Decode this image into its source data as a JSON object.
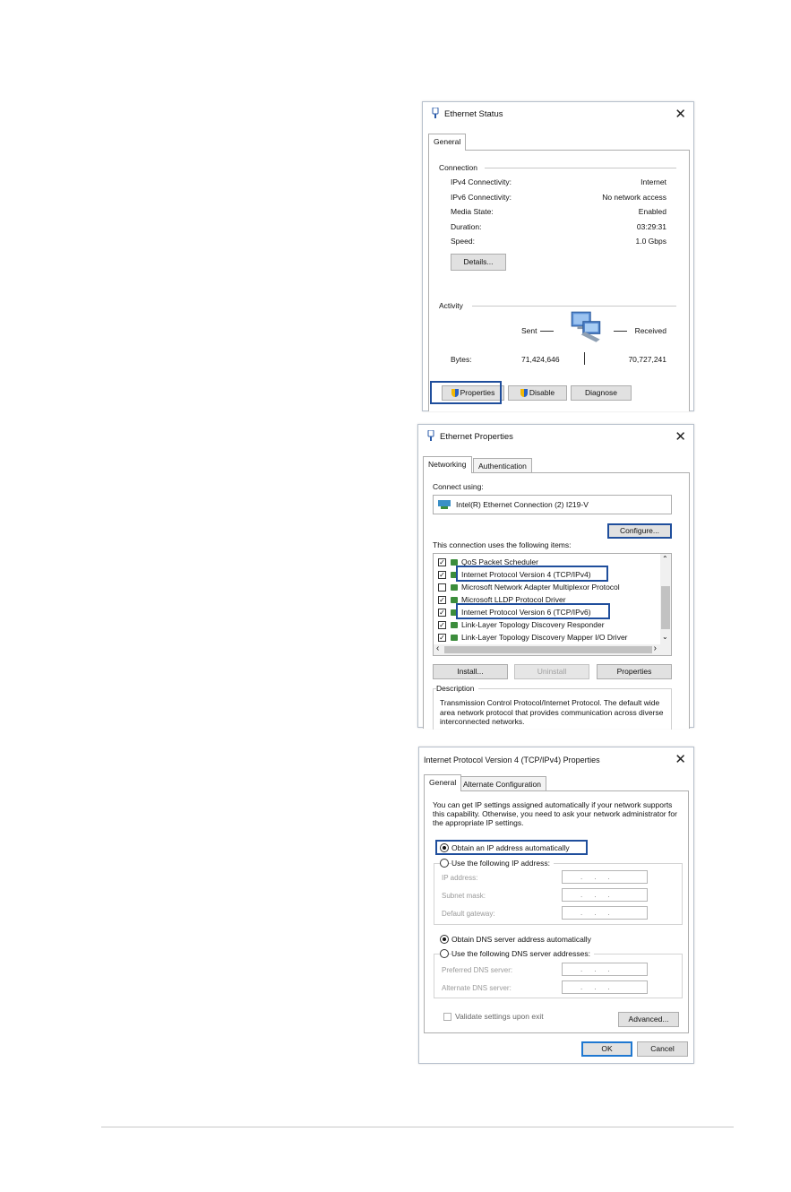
{
  "status_dialog": {
    "title": "Ethernet Status",
    "tab": "General",
    "connection_label": "Connection",
    "rows": [
      {
        "label": "IPv4 Connectivity:",
        "value": "Internet"
      },
      {
        "label": "IPv6 Connectivity:",
        "value": "No network access"
      },
      {
        "label": "Media State:",
        "value": "Enabled"
      },
      {
        "label": "Duration:",
        "value": "03:29:31"
      },
      {
        "label": "Speed:",
        "value": "1.0 Gbps"
      }
    ],
    "details_button": "Details...",
    "activity_label": "Activity",
    "sent_label": "Sent",
    "received_label": "Received",
    "bytes_label": "Bytes:",
    "bytes_sent": "71,424,646",
    "bytes_received": "70,727,241",
    "properties_button": "Properties",
    "disable_button": "Disable",
    "diagnose_button": "Diagnose"
  },
  "properties_dialog": {
    "title": "Ethernet Properties",
    "tabs": [
      "Networking",
      "Authentication"
    ],
    "connect_using_label": "Connect using:",
    "adapter_name": "Intel(R) Ethernet Connection (2) I219-V",
    "configure_button": "Configure...",
    "items_label": "This connection uses the following items:",
    "items": [
      {
        "label": "QoS Packet Scheduler",
        "checked": true
      },
      {
        "label": "Internet Protocol Version 4 (TCP/IPv4)",
        "checked": true
      },
      {
        "label": "Microsoft Network Adapter Multiplexor Protocol",
        "checked": false
      },
      {
        "label": "Microsoft LLDP Protocol Driver",
        "checked": true
      },
      {
        "label": "Internet Protocol Version 6 (TCP/IPv6)",
        "checked": true
      },
      {
        "label": "Link-Layer Topology Discovery Responder",
        "checked": true
      },
      {
        "label": "Link-Layer Topology Discovery Mapper I/O Driver",
        "checked": true
      }
    ],
    "install_button": "Install...",
    "uninstall_button": "Uninstall",
    "properties_button": "Properties",
    "description_label": "Description",
    "description_text": "Transmission Control Protocol/Internet Protocol. The default wide area network protocol that provides communication across diverse interconnected networks."
  },
  "ipv4_dialog": {
    "title": "Internet Protocol Version 4 (TCP/IPv4) Properties",
    "tabs": [
      "General",
      "Alternate Configuration"
    ],
    "intro_text": "You can get IP settings assigned automatically if your network supports this capability. Otherwise, you need to ask your network administrator for the appropriate IP settings.",
    "obtain_ip_auto": "Obtain an IP address automatically",
    "use_following_ip": "Use the following IP address:",
    "ip_address_label": "IP address:",
    "subnet_mask_label": "Subnet mask:",
    "default_gateway_label": "Default gateway:",
    "obtain_dns_auto": "Obtain DNS server address automatically",
    "use_following_dns": "Use the following DNS server addresses:",
    "preferred_dns_label": "Preferred DNS server:",
    "alternate_dns_label": "Alternate DNS server:",
    "ip_placeholder": "...",
    "validate_label": "Validate settings upon exit",
    "advanced_button": "Advanced...",
    "ok_button": "OK",
    "cancel_button": "Cancel"
  },
  "colors": {
    "highlight": "#1f4e9c",
    "button_bg": "#e1e1e1",
    "border": "#adadad"
  }
}
